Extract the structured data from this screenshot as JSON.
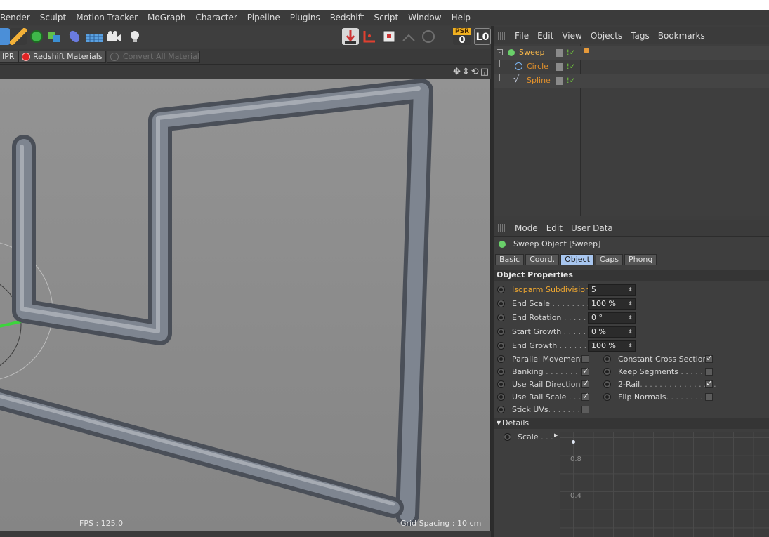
{
  "menu": [
    "Render",
    "Sculpt",
    "Motion Tracker",
    "MoGraph",
    "Character",
    "Pipeline",
    "Plugins",
    "Redshift",
    "Script",
    "Window",
    "Help"
  ],
  "toolbar": {
    "psr_label": "PSR",
    "psr_value": "0",
    "layer_label": "L0"
  },
  "redshift_bar": {
    "ipr": "IPR",
    "materials": "Redshift Materials",
    "convert": "Convert All Material"
  },
  "viewport": {
    "fps": "FPS : 125.0",
    "grid_spacing": "Grid Spacing : 10 cm"
  },
  "object_manager": {
    "menu": [
      "File",
      "Edit",
      "View",
      "Objects",
      "Tags",
      "Bookmarks"
    ],
    "objects": [
      {
        "name": "Sweep",
        "color": "#f5b64a"
      },
      {
        "name": "Circle",
        "color": "#e0902c"
      },
      {
        "name": "Spline",
        "color": "#e0902c"
      }
    ]
  },
  "attributes": {
    "menu": [
      "Mode",
      "Edit",
      "User Data"
    ],
    "object_title": "Sweep Object [Sweep]",
    "tabs": [
      "Basic",
      "Coord.",
      "Object",
      "Caps",
      "Phong"
    ],
    "active_tab": "Object",
    "section": "Object Properties",
    "fields": [
      {
        "label": "Isoparm Subdivision",
        "dots": "",
        "value": "5",
        "highlight": true
      },
      {
        "label": "End Scale",
        "dots": " . . . . . . . . .",
        "value": "100 %"
      },
      {
        "label": "End Rotation",
        "dots": " . . . . . .",
        "value": "0 °"
      },
      {
        "label": "Start Growth",
        "dots": " . . . . . .",
        "value": "0 %"
      },
      {
        "label": "End Growth",
        "dots": " . . . . . . .",
        "value": "100 %"
      }
    ],
    "checks_left": [
      {
        "label": "Parallel Movement",
        "dots": " ",
        "checked": false
      },
      {
        "label": "Banking",
        "dots": " . . . . . . . .",
        "checked": true
      },
      {
        "label": "Use Rail Direction",
        "dots": " ",
        "checked": true
      },
      {
        "label": "Use Rail Scale",
        "dots": " . . . .",
        "checked": true
      },
      {
        "label": "Stick UVs",
        "dots": ". . . . . . . .",
        "checked": false
      }
    ],
    "checks_right": [
      {
        "label": "Constant Cross Section",
        "dots": " ",
        "checked": true
      },
      {
        "label": "Keep Segments",
        "dots": " . . . . . .",
        "checked": false
      },
      {
        "label": "2-Rail",
        "dots": ". . . . . . . . . . . . . . . .",
        "checked": true
      },
      {
        "label": "Flip Normals",
        "dots": ". . . . . . . . . .",
        "checked": false
      }
    ],
    "details_label": "Details",
    "scale_label": "Scale",
    "scale_dots": " . . .",
    "graph_y": [
      "0.8",
      "0.4"
    ]
  }
}
